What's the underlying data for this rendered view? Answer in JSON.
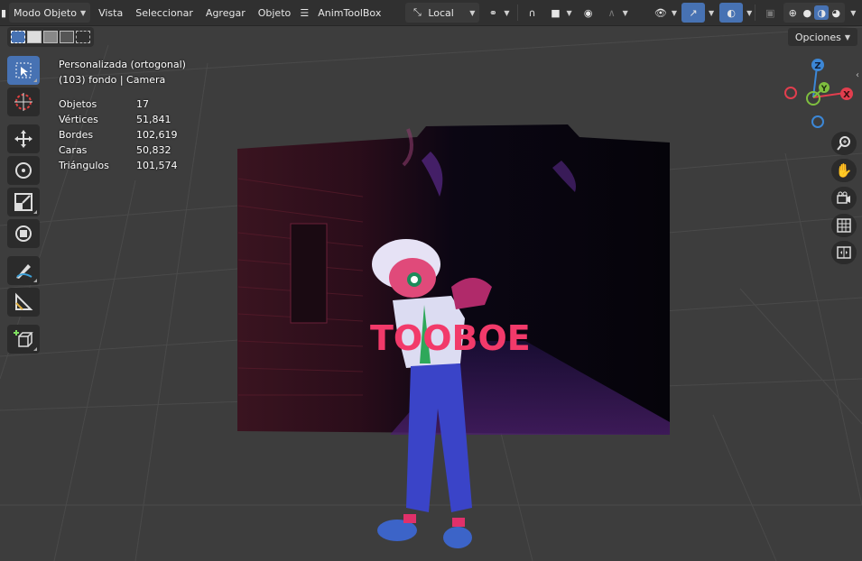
{
  "header": {
    "mode_label": "Modo Objeto",
    "menu": [
      "Vista",
      "Seleccionar",
      "Agregar",
      "Objeto",
      "AnimToolBox"
    ],
    "transform_orientation": "Local",
    "options_label": "Opciones"
  },
  "overlay": {
    "view_name": "Personalizada (ortogonal)",
    "object_info": "(103) fondo | Camera",
    "stats": [
      {
        "label": "Objetos",
        "value": "17"
      },
      {
        "label": "Vértices",
        "value": "51,841"
      },
      {
        "label": "Bordes",
        "value": "102,619"
      },
      {
        "label": "Caras",
        "value": "50,832"
      },
      {
        "label": "Triángulos",
        "value": "101,574"
      }
    ]
  },
  "gizmo": {
    "z": "Z",
    "y": "Y",
    "x": "X"
  },
  "scene_text": "TOOBOE",
  "colors": {
    "accent": "#4772b3",
    "header_bg": "#303030",
    "viewport_bg": "#3d3d3d",
    "axis_x": "#e23e4e",
    "axis_y": "#7fbf3f",
    "axis_z": "#3c87d6"
  },
  "icons": [
    "editor-type-icon",
    "hamburger-icon",
    "transform-orientation-icon",
    "pivot-icon",
    "snap-icon",
    "proportional-edit-icon",
    "visibility-icon",
    "gizmo-icon",
    "overlay-icon",
    "xray-icon",
    "wireframe-shading-icon",
    "solid-shading-icon",
    "material-shading-icon",
    "rendered-shading-icon",
    "select-box-icon",
    "cursor-icon",
    "move-icon",
    "rotate-icon",
    "scale-icon",
    "transform-icon",
    "annotate-icon",
    "measure-icon",
    "add-cube-icon",
    "zoom-icon",
    "hand-icon",
    "camera-icon",
    "grid-icon"
  ]
}
